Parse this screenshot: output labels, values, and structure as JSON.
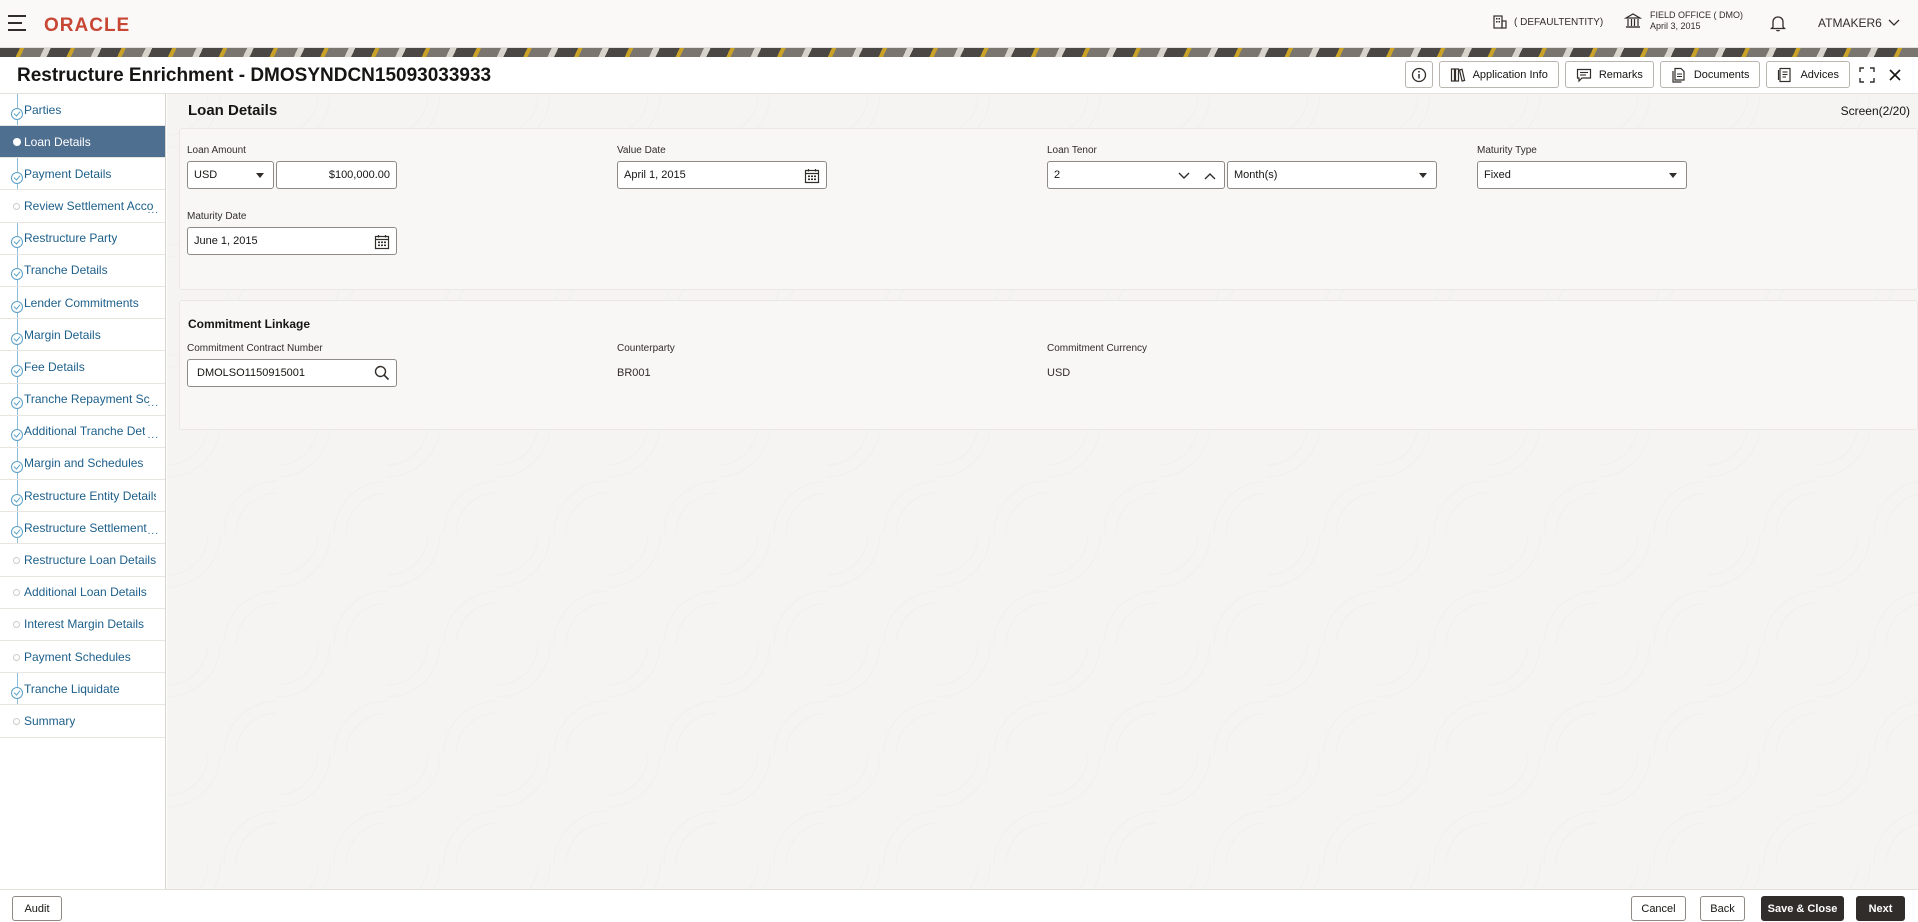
{
  "header": {
    "logo": "ORACLE",
    "entity": "( DEFAULTENTITY)",
    "office_name": "FIELD OFFICE ( DMO)",
    "office_date": "April 3, 2015",
    "user": "ATMAKER6"
  },
  "titlebar": {
    "title": "Restructure Enrichment - DMOSYNDCN15093033933",
    "application_info": "Application Info",
    "remarks": "Remarks",
    "documents": "Documents",
    "advices": "Advices"
  },
  "sidebar": {
    "items": [
      {
        "label": "Parties",
        "state": "done"
      },
      {
        "label": "Loan Details",
        "state": "current"
      },
      {
        "label": "Payment Details",
        "state": "done"
      },
      {
        "label": "Review Settlement Acco",
        "state": "pending",
        "truncated": true
      },
      {
        "label": "Restructure Party",
        "state": "done"
      },
      {
        "label": "Tranche Details",
        "state": "done"
      },
      {
        "label": "Lender Commitments",
        "state": "done"
      },
      {
        "label": "Margin Details",
        "state": "done"
      },
      {
        "label": "Fee Details",
        "state": "done"
      },
      {
        "label": "Tranche Repayment Sc",
        "state": "done",
        "truncated": true
      },
      {
        "label": "Additional Tranche Det",
        "state": "done",
        "truncated": true
      },
      {
        "label": "Margin and Schedules",
        "state": "done"
      },
      {
        "label": "Restructure Entity Details",
        "state": "done"
      },
      {
        "label": "Restructure Settlement",
        "state": "done",
        "truncated": true
      },
      {
        "label": "Restructure Loan Details",
        "state": "pending"
      },
      {
        "label": "Additional Loan Details",
        "state": "pending"
      },
      {
        "label": "Interest Margin Details",
        "state": "pending"
      },
      {
        "label": "Payment Schedules",
        "state": "pending"
      },
      {
        "label": "Tranche Liquidate",
        "state": "done"
      },
      {
        "label": "Summary",
        "state": "pending"
      }
    ],
    "more_glyph": "..."
  },
  "main": {
    "section_title": "Loan Details",
    "screen_count": "Screen(2/20)",
    "loan": {
      "loan_amount_label": "Loan Amount",
      "currency": "USD",
      "amount": "$100,000.00",
      "value_date_label": "Value Date",
      "value_date": "April 1, 2015",
      "loan_tenor_label": "Loan Tenor",
      "tenor_value": "2",
      "tenor_unit": "Month(s)",
      "maturity_type_label": "Maturity Type",
      "maturity_type": "Fixed",
      "maturity_date_label": "Maturity Date",
      "maturity_date": "June 1, 2015"
    },
    "commitment": {
      "title": "Commitment Linkage",
      "contract_number_label": "Commitment Contract Number",
      "contract_number": "DMOLSO1150915001",
      "counterparty_label": "Counterparty",
      "counterparty": "BR001",
      "currency_label": "Commitment Currency",
      "currency": "USD"
    }
  },
  "footer": {
    "audit": "Audit",
    "cancel": "Cancel",
    "back": "Back",
    "save_close": "Save & Close",
    "next": "Next"
  },
  "colors": {
    "brand": "#c74634",
    "active_step": "#4f6f91",
    "link": "#1d5f8a",
    "primary_button": "#312d2a"
  }
}
